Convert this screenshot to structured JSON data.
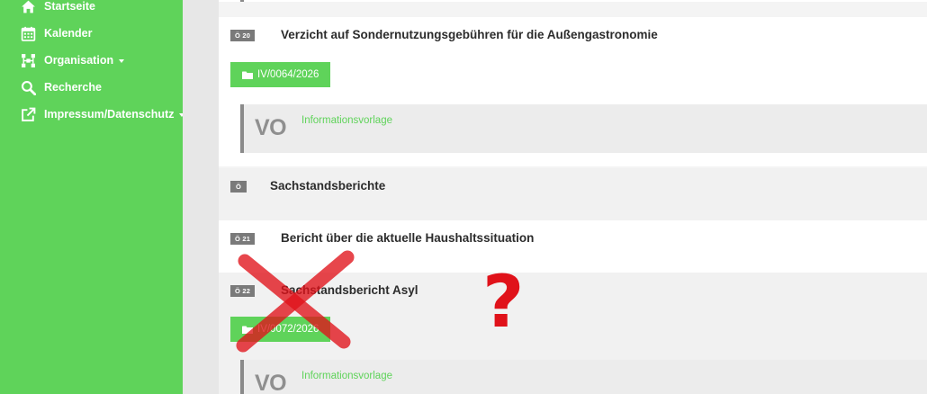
{
  "sidebar": {
    "items": [
      {
        "label": "Startseite",
        "icon": "home-icon",
        "has_caret": false
      },
      {
        "label": "Kalender",
        "icon": "calendar-icon",
        "has_caret": false
      },
      {
        "label": "Organisation",
        "icon": "organisation-icon",
        "has_caret": true
      },
      {
        "label": "Recherche",
        "icon": "search-icon",
        "has_caret": false
      },
      {
        "label": "Impressum/Datenschutz",
        "icon": "external-link-icon",
        "has_caret": true
      }
    ],
    "color": "#5fd35a"
  },
  "agenda": {
    "item20": {
      "tag": "Ö 20",
      "title": "Verzicht auf Sondernutzungsgebühren für die Außengastronomie",
      "doc_number": "IV/0064/2026",
      "doc_type_short": "VO",
      "doc_type": "Informationsvorlage"
    },
    "section": {
      "tag": "Ö",
      "title": "Sachstandsberichte"
    },
    "item21": {
      "tag": "Ö 21",
      "title": "Bericht über die aktuelle Haushaltssituation"
    },
    "item22": {
      "tag": "Ö 22",
      "title": "Sachstandsbericht Asyl",
      "doc_number": "IV/0072/2026",
      "doc_type_short": "VO",
      "doc_type": "Informationsvorlage"
    }
  },
  "annotations": {
    "cross_color": "#e0121a",
    "question_mark": "?"
  }
}
